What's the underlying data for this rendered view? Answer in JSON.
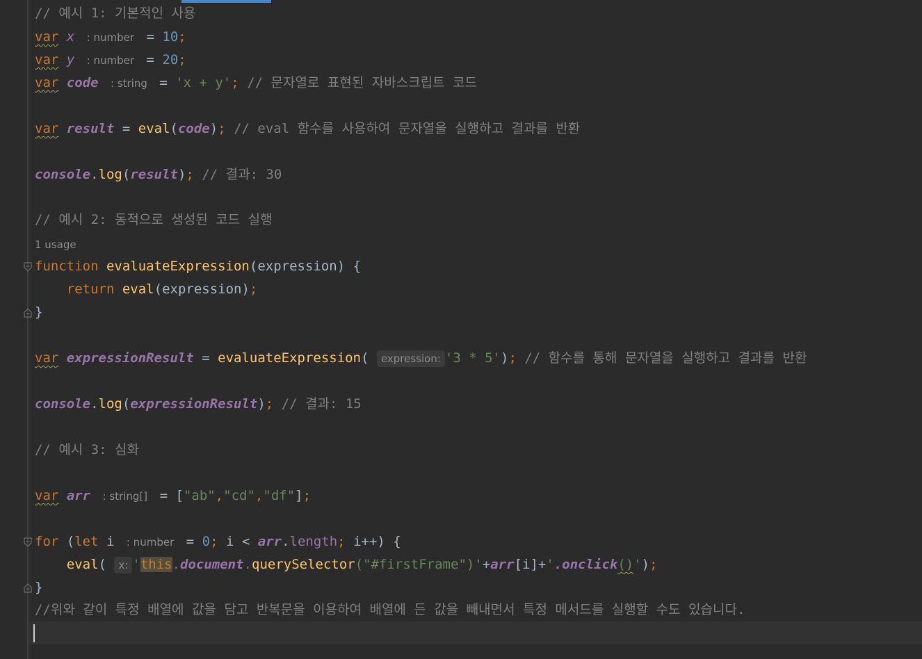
{
  "editor": {
    "language": "javascript",
    "usage_hint": "1 usage",
    "inlay_hints": {
      "x_type": ": number",
      "y_type": ": number",
      "code_type": ": string",
      "arr_type": ": string[]",
      "i_type": ": number",
      "expression_param": "expression:",
      "x_param": "x:"
    },
    "lines": {
      "l1_comment": "// 예시 1: 기본적인 사용",
      "kw_var": "var",
      "x_name": "x",
      "y_name": "y",
      "code_name": "code",
      "result_name": "result",
      "assign": " = ",
      "x_value": "10",
      "y_value": "20",
      "code_value": "'x + y'",
      "semicolon": ";",
      "l4_comment": "// 문자열로 표현된 자바스크립트 코드",
      "eval_fn": "eval",
      "l6_comment": "// eval 함수를 사용하여 문자열을 실행하고 결과를 반환",
      "console": "console",
      "log": "log",
      "l8_comment": "// 결과: 30",
      "l10_comment": "// 예시 2: 동적으로 생성된 코드 실행",
      "kw_function": "function",
      "evaluate_fn": "evaluateExpression",
      "param_expression": "expression",
      "kw_return": "return",
      "close_brace": "}",
      "expression_result": "expressionResult",
      "three_times_five": "'3 * 5'",
      "l15_comment": "// 함수를 통해 문자열을 실행하고 결과를 반환",
      "l17_comment": "// 결과: 15",
      "l19_comment": "// 예시 3: 심화",
      "arr_name": "arr",
      "arr_values": [
        "\"ab\"",
        "\"cd\"",
        "\"df\""
      ],
      "kw_for": "for",
      "kw_let": "let",
      "i_name": "i",
      "zero": "0",
      "length": "length",
      "kw_this": "this",
      "document": "document",
      "query_selector": "querySelector",
      "selector_str": "\"#firstFrame\"",
      "onclick": ".onclick",
      "l26_comment": "//위와 같이 특정 배열에 값을 담고 반복문을 이용하여 배열에 든 값을 빼내면서 특정 메서드를 실행할 수도 있습니다."
    }
  },
  "colors": {
    "background": "#2b2b2b",
    "keyword": "#cc7832",
    "number": "#6897bb",
    "string": "#6a8759",
    "comment": "#808080",
    "global_var": "#9876aa",
    "function": "#ffc66d",
    "text": "#a9b7c6"
  }
}
